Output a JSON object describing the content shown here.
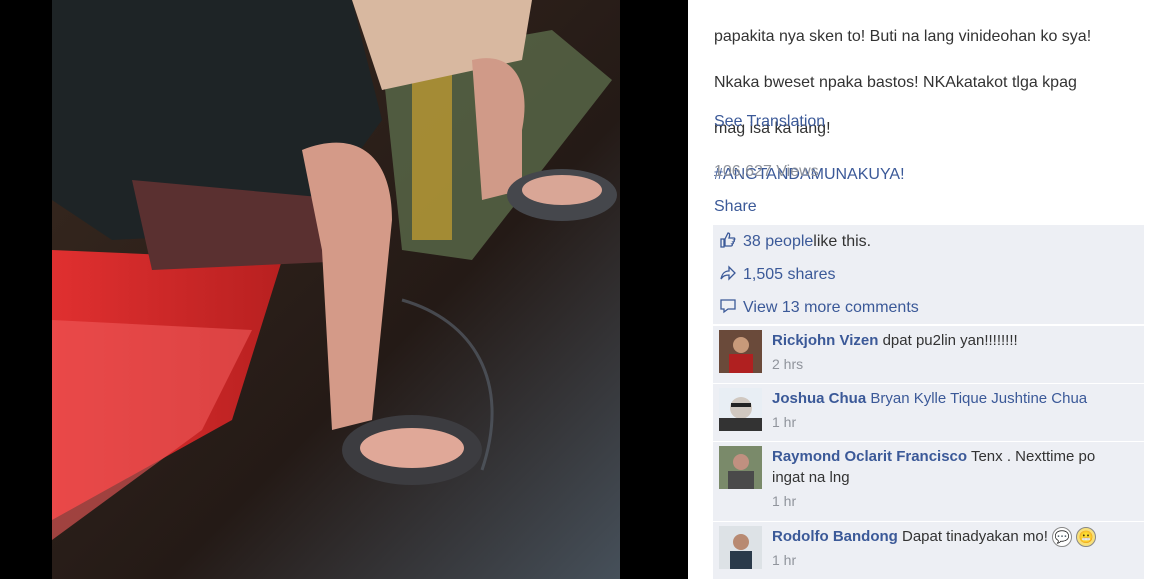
{
  "post": {
    "caption_lines": [
      "papakita nya sken to! Buti na lang vinideohan ko sya!",
      "Nkaka bweset npaka bastos! NKAkatakot tlga kpag",
      "mag isa ka lang!"
    ],
    "hashtag": "#ANGTANDAMUNAKUYA!",
    "see_translation": "See Translation",
    "views": "106,627 Views",
    "share": "Share"
  },
  "stats": {
    "likes_label": "38 people",
    "likes_suffix": " like this.",
    "shares_label": "1,505 shares",
    "view_more_comments": "View 13 more comments",
    "like_icon": "thumbs-up-icon",
    "share_icon": "share-arrow-icon",
    "comment_icon": "speech-bubble-icon"
  },
  "comments": [
    {
      "name": "Rickjohn Vizen",
      "text": "dpat pu2lin yan!!!!!!!!",
      "time": "2 hrs"
    },
    {
      "name": "Joshua Chua",
      "text": "Bryan Kylle Tique Jushtine Chua",
      "time": "1 hr"
    },
    {
      "name": "Raymond Oclarit Francisco",
      "text": "Tenx . Nexttime po ingat na lng",
      "time": "1 hr"
    },
    {
      "name": "Rodolfo Bandong",
      "text": "Dapat tinadyakan mo!",
      "time": "1 hr"
    }
  ],
  "colors": {
    "link": "#3b5998",
    "panel": "#edeff4",
    "muted": "#90949c"
  }
}
